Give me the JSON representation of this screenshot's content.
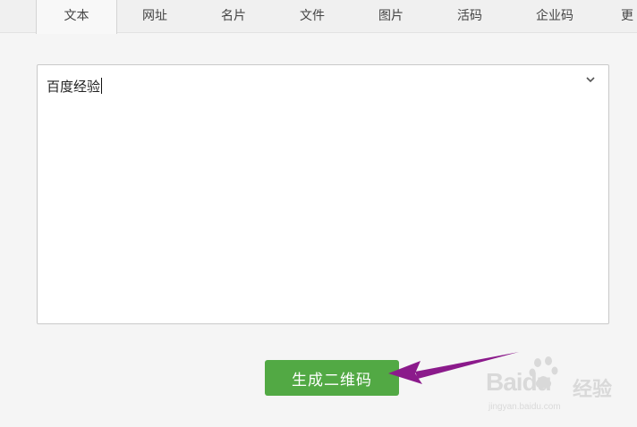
{
  "tabs": [
    {
      "label": "文本",
      "active": true
    },
    {
      "label": "网址",
      "active": false
    },
    {
      "label": "名片",
      "active": false
    },
    {
      "label": "文件",
      "active": false
    },
    {
      "label": "图片",
      "active": false
    },
    {
      "label": "活码",
      "active": false
    },
    {
      "label": "企业码",
      "active": false
    },
    {
      "label": "更",
      "active": false
    }
  ],
  "editor": {
    "value": "百度经验",
    "dropdown_icon": "chevron-down-icon"
  },
  "generate_button": {
    "label": "生成二维码",
    "color": "#52a944"
  },
  "annotation": {
    "arrow_color": "#8b1a8b"
  },
  "watermark": {
    "brand": "Baidu",
    "brand_cn": "经验",
    "url": "jingyan.baidu.com"
  }
}
